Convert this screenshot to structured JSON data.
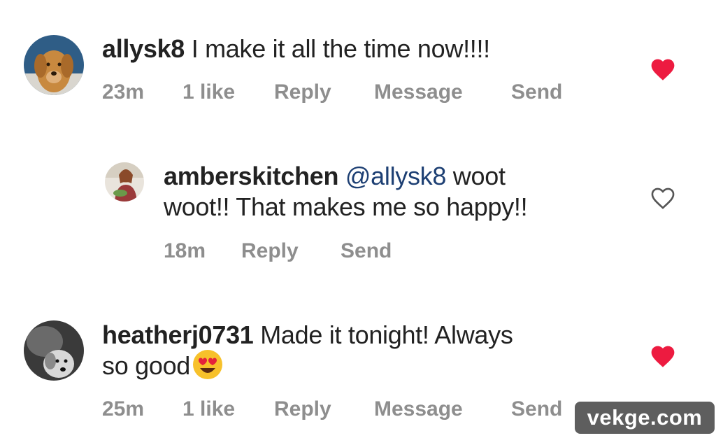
{
  "comments": [
    {
      "username": "allysk8",
      "text": " I make it all the time now!!!!",
      "time": "23m",
      "likes": "1 like",
      "reply": "Reply",
      "message": "Message",
      "send": "Send",
      "liked": true,
      "avatar_icon": "dog-avatar-icon"
    },
    {
      "username": "amberskitchen",
      "mention": " @allysk8",
      "text_line1": " woot",
      "text_line2": "woot!! That makes me so happy!!",
      "time": "18m",
      "reply": "Reply",
      "send": "Send",
      "liked": false,
      "avatar_icon": "person-avatar-icon"
    },
    {
      "username": "heatherj0731",
      "text_line1": " Made it tonight!  Always",
      "text_line2": "so good",
      "emoji": "heart-eyes-emoji",
      "time": "25m",
      "likes": "1 like",
      "reply": "Reply",
      "message": "Message",
      "send": "Send",
      "liked": true,
      "avatar_icon": "dog-bw-avatar-icon"
    }
  ],
  "watermark": "vekge.com",
  "colors": {
    "liked_heart": "#ed1b40",
    "meta": "#8e8e8e",
    "mention": "#1d3f73"
  }
}
